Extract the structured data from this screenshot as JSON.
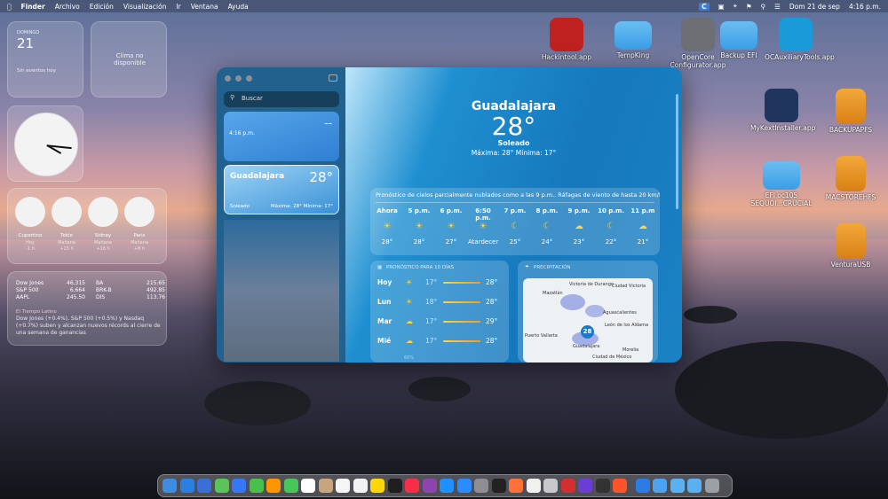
{
  "menubar": {
    "items": [
      "Finder",
      "Archivo",
      "Edición",
      "Visualización",
      "Ir",
      "Ventana",
      "Ayuda"
    ],
    "right": {
      "badge": "C",
      "date": "Dom 21 de sep",
      "time": "4:16 p.m."
    }
  },
  "widgets": {
    "calendar": {
      "day": "DOMINGO",
      "date": "21",
      "events": "Sin eventos hoy"
    },
    "weather_small": "Clima no disponible",
    "world_clocks": [
      {
        "city": "Cupertino",
        "day": "Hoy",
        "offset": "-1 h"
      },
      {
        "city": "Tokio",
        "day": "Mañana",
        "offset": "+15 h"
      },
      {
        "city": "Sidney",
        "day": "Mañana",
        "offset": "+16 h"
      },
      {
        "city": "Paris",
        "day": "Mañana",
        "offset": "+8 h"
      }
    ],
    "stocks": [
      {
        "name": "Dow Jones",
        "value": "46,315"
      },
      {
        "name": "S&P 500",
        "value": "6,664"
      },
      {
        "name": "AAPL",
        "value": "245.50"
      },
      {
        "name": "BA",
        "value": "215.65"
      },
      {
        "name": "BRK-B",
        "value": "492.85"
      },
      {
        "name": "DIS",
        "value": "113.76"
      }
    ],
    "news_source": "El Tiempo Latino",
    "news_text": "Dow Jones (+0.4%), S&P 500 (+0.5%) y Nasdaq (+0.7%) suben y alcanzan nuevos récords al cierre de una semana de ganancias"
  },
  "desktop_icons": [
    {
      "label": "Hackintool.app"
    },
    {
      "label": "TempKing"
    },
    {
      "label": "OpenCore Configurator.app"
    },
    {
      "label": "Backup EFI"
    },
    {
      "label": "OCAuxiliaryTools.app"
    },
    {
      "label": "MyKextInstaller.app"
    },
    {
      "label": "BACKUPAPFS"
    },
    {
      "label": "EFI oc105 SEQUOI...CRUCIAL"
    },
    {
      "label": "MACSTOREHFS"
    },
    {
      "label": "VenturaUSB"
    }
  ],
  "weather": {
    "search_placeholder": "Buscar",
    "cards": [
      {
        "name": "",
        "time": "4:16 p.m.",
        "temp": "--"
      },
      {
        "name": "Guadalajara",
        "time": "Soleado",
        "temp": "28°",
        "range": "Máxima: 28° Mínima: 17°"
      }
    ],
    "city": "Guadalajara",
    "temp": "28°",
    "condition": "Soleado",
    "range": "Máxima: 28°  Mínima: 17°",
    "summary": "Pronóstico de cielos parcialmente nublados como a las 9 p.m.. Ráfagas de viento de hasta 20 km/h.",
    "hourly": [
      {
        "time": "Ahora",
        "temp": "28°"
      },
      {
        "time": "5 p.m.",
        "temp": "28°"
      },
      {
        "time": "6 p.m.",
        "temp": "27°"
      },
      {
        "time": "6:50 p.m.",
        "temp": "Atardecer"
      },
      {
        "time": "7 p.m.",
        "temp": "25°"
      },
      {
        "time": "8 p.m.",
        "temp": "24°"
      },
      {
        "time": "9 p.m.",
        "temp": "23°"
      },
      {
        "time": "10 p.m.",
        "temp": "22°"
      },
      {
        "time": "11 p.m",
        "temp": "21°"
      }
    ],
    "forecast_title": "PRONÓSTICO PARA 10 DÍAS",
    "forecast": [
      {
        "day": "Hoy",
        "low": "17°",
        "high": "28°"
      },
      {
        "day": "Lun",
        "low": "18°",
        "high": "28°"
      },
      {
        "day": "Mar",
        "low": "17°",
        "high": "29°"
      },
      {
        "day": "Mié",
        "low": "17°",
        "high": "28°"
      }
    ],
    "forecast_extra": "60%",
    "precip_title": "PRECIPITACIÓN",
    "map_labels": [
      "Victoria de Durango",
      "Ciudad Victoria",
      "Mazatlán",
      "Aguascalientes",
      "León de los Aldama",
      "Puerto Vallarta",
      "Guadalajara",
      "Morelia",
      "Ciudad de México"
    ],
    "map_temp": "28"
  }
}
